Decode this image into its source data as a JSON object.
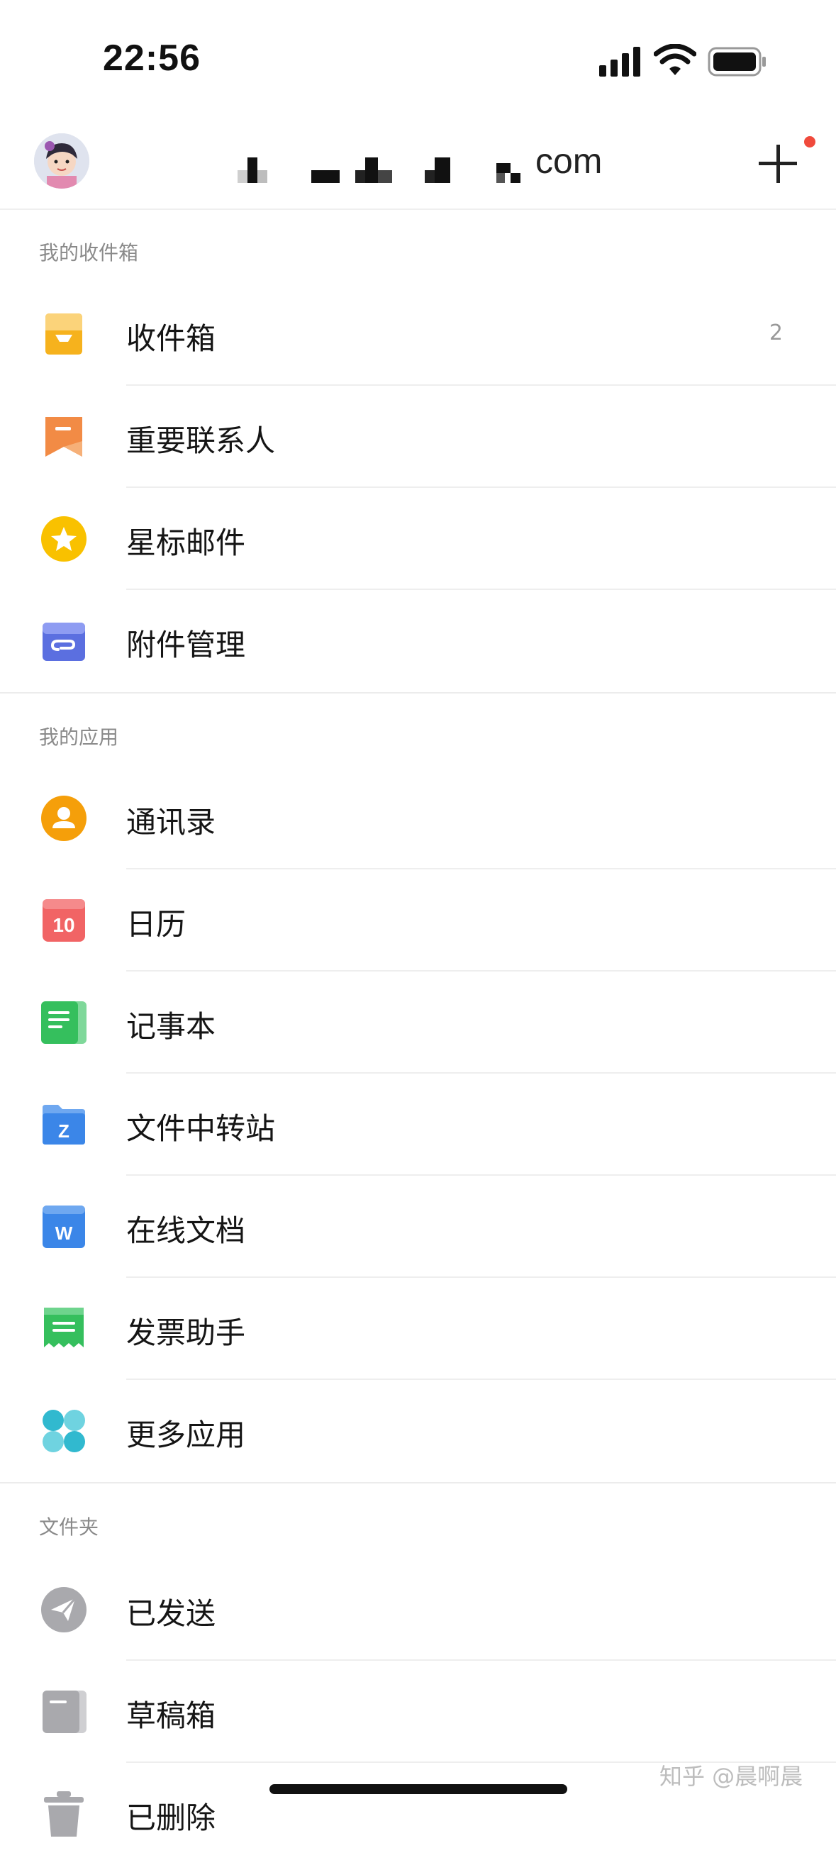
{
  "status": {
    "time": "22:56"
  },
  "header": {
    "account_suffix": "com"
  },
  "sections": {
    "mailbox": {
      "title": "我的收件箱",
      "items": [
        {
          "label": "收件箱",
          "count": "2",
          "icon": "inbox-icon"
        },
        {
          "label": "重要联系人",
          "icon": "bookmark-icon"
        },
        {
          "label": "星标邮件",
          "icon": "star-icon"
        },
        {
          "label": "附件管理",
          "icon": "attachment-icon"
        }
      ]
    },
    "apps": {
      "title": "我的应用",
      "items": [
        {
          "label": "通讯录",
          "icon": "contacts-icon"
        },
        {
          "label": "日历",
          "icon": "calendar-icon",
          "badge": "10"
        },
        {
          "label": "记事本",
          "icon": "notebook-icon"
        },
        {
          "label": "文件中转站",
          "icon": "folder-z-icon",
          "glyph": "Z"
        },
        {
          "label": "在线文档",
          "icon": "doc-w-icon",
          "glyph": "W"
        },
        {
          "label": "发票助手",
          "icon": "invoice-icon"
        },
        {
          "label": "更多应用",
          "icon": "more-apps-icon"
        }
      ]
    },
    "folders": {
      "title": "文件夹",
      "items": [
        {
          "label": "已发送",
          "icon": "send-icon"
        },
        {
          "label": "草稿箱",
          "icon": "draft-icon"
        },
        {
          "label": "已删除",
          "icon": "trash-icon"
        }
      ]
    }
  },
  "watermark": "知乎 @晨啊晨",
  "colors": {
    "inbox": "#f6b21d",
    "bookmark": "#f28b45",
    "star": "#f9c100",
    "attachment": "#5b6fe0",
    "contacts": "#f59f0a",
    "calendar": "#f16465",
    "notebook": "#35bf5d",
    "folder": "#3b86e8",
    "doc": "#3b86e8",
    "invoice": "#35bf5d",
    "more": "#31b9cf",
    "gray": "#a9a9ad"
  }
}
